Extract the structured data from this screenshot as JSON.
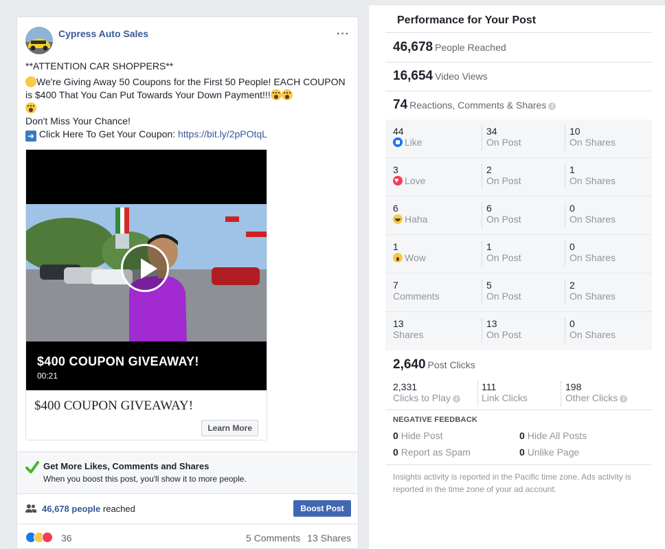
{
  "post": {
    "page_name": "Cypress Auto Sales",
    "more_label": "···",
    "lines": {
      "l1": "**ATTENTION CAR SHOPPERS**",
      "l2a": "We're Giving Away 50 Coupons for the First 50 People! EACH COUPON is $400 That You Can Put Towards Your Down Payment!!!",
      "l3": "Don't Miss Your Chance!",
      "l4": " Click Here To Get Your Coupon: ",
      "link": "https://bit.ly/2pPOtqL"
    },
    "video": {
      "title": "$400 COUPON GIVEAWAY!",
      "duration": "00:21"
    },
    "caption": "$400 COUPON GIVEAWAY!",
    "learn_more": "Learn More",
    "promo": {
      "title": "Get More Likes, Comments and Shares",
      "subtitle": "When you boost this post, you'll show it to more people."
    },
    "reach": {
      "count": "46,678 people",
      "suffix": " reached",
      "boost_label": "Boost Post"
    },
    "footer": {
      "reactions": "36",
      "comments": "5 Comments",
      "shares": "13 Shares"
    }
  },
  "performance": {
    "title": "Performance for Your Post",
    "people_reached": {
      "value": "46,678",
      "label": "People Reached"
    },
    "video_views": {
      "value": "16,654",
      "label": "Video Views"
    },
    "engagement": {
      "value": "74",
      "label": "Reactions, Comments & Shares"
    },
    "rows": [
      {
        "total": "44",
        "label": "Like",
        "icon": "like-icon",
        "on_post": "34",
        "on_post_label": "On Post",
        "on_shares": "10",
        "on_shares_label": "On Shares"
      },
      {
        "total": "3",
        "label": "Love",
        "icon": "love-icon",
        "on_post": "2",
        "on_post_label": "On Post",
        "on_shares": "1",
        "on_shares_label": "On Shares"
      },
      {
        "total": "6",
        "label": "Haha",
        "icon": "haha-icon",
        "on_post": "6",
        "on_post_label": "On Post",
        "on_shares": "0",
        "on_shares_label": "On Shares"
      },
      {
        "total": "1",
        "label": "Wow",
        "icon": "wow-icon",
        "on_post": "1",
        "on_post_label": "On Post",
        "on_shares": "0",
        "on_shares_label": "On Shares"
      },
      {
        "total": "7",
        "label": "Comments",
        "icon": "",
        "on_post": "5",
        "on_post_label": "On Post",
        "on_shares": "2",
        "on_shares_label": "On Shares"
      },
      {
        "total": "13",
        "label": "Shares",
        "icon": "",
        "on_post": "13",
        "on_post_label": "On Post",
        "on_shares": "0",
        "on_shares_label": "On Shares"
      }
    ],
    "post_clicks": {
      "value": "2,640",
      "label": "Post Clicks"
    },
    "clicks": [
      {
        "value": "2,331",
        "label": "Clicks to Play"
      },
      {
        "value": "111",
        "label": "Link Clicks"
      },
      {
        "value": "198",
        "label": "Other Clicks"
      }
    ],
    "negative": {
      "title": "NEGATIVE FEEDBACK",
      "hide_post": {
        "value": "0",
        "label": "Hide Post"
      },
      "hide_all": {
        "value": "0",
        "label": "Hide All Posts"
      },
      "spam": {
        "value": "0",
        "label": "Report as Spam"
      },
      "unlike": {
        "value": "0",
        "label": "Unlike Page"
      }
    },
    "footnote": "Insights activity is reported in the Pacific time zone. Ads activity is reported in the time zone of your ad account."
  },
  "colors": {
    "brand_blue": "#4267b2",
    "link_blue": "#365899",
    "background": "#e9ebee"
  }
}
